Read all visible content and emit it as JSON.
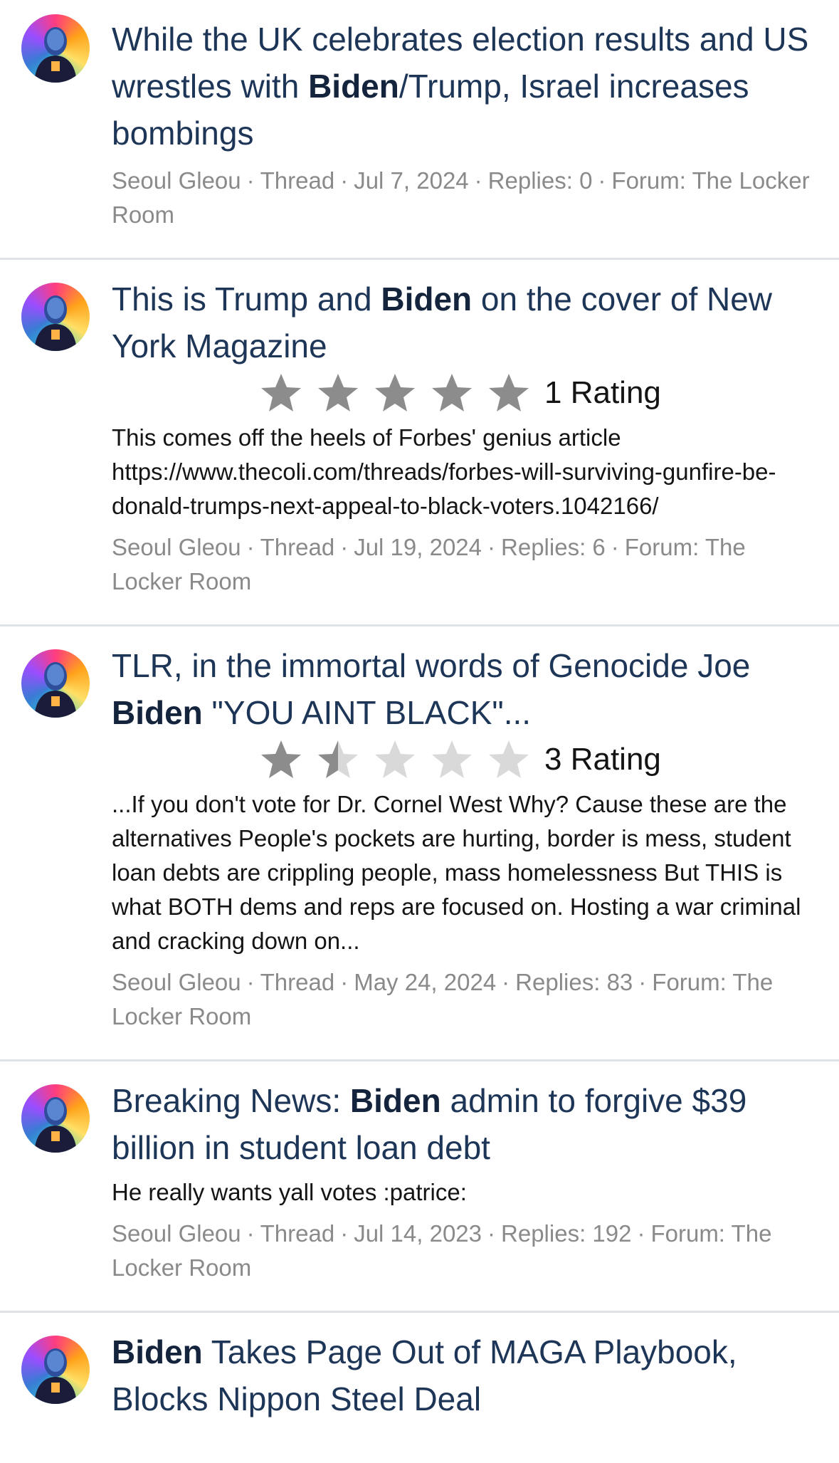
{
  "results": [
    {
      "title_parts": [
        "While the UK celebrates election results and US wrestles with ",
        "Biden",
        "/Trump, Israel increases bombings"
      ],
      "rating": null,
      "snippet": "",
      "author": "Seoul Gleou",
      "type": "Thread",
      "date": "Jul 7, 2024",
      "replies": "Replies: 0",
      "forum": "Forum: The Locker Room"
    },
    {
      "title_parts": [
        "This is Trump and ",
        "Biden",
        " on the cover of New York Magazine"
      ],
      "rating": {
        "value": 5,
        "max": 5,
        "label": "1 Rating"
      },
      "snippet": "This comes off the heels of Forbes' genius article https://www.thecoli.com/threads/forbes-will-surviving-gunfire-be-donald-trumps-next-appeal-to-black-voters.1042166/",
      "author": "Seoul Gleou",
      "type": "Thread",
      "date": "Jul 19, 2024",
      "replies": "Replies: 6",
      "forum": "Forum: The Locker Room"
    },
    {
      "title_parts": [
        "TLR, in the immortal words of Genocide Joe ",
        "Biden",
        " \"YOU AINT BLACK\"..."
      ],
      "rating": {
        "value": 1.5,
        "max": 5,
        "label": "3 Rating"
      },
      "snippet": "...If you don't vote for Dr. Cornel West Why? Cause these are the alternatives People's pockets are hurting, border is mess, student loan debts are crippling people, mass homelessness But THIS is what BOTH dems and reps are focused on. Hosting a war criminal and cracking down on...",
      "author": "Seoul Gleou",
      "type": "Thread",
      "date": "May 24, 2024",
      "replies": "Replies: 83",
      "forum": "Forum: The Locker Room"
    },
    {
      "title_parts": [
        "Breaking News: ",
        "Biden",
        " admin to forgive $39 billion in student loan debt"
      ],
      "rating": null,
      "snippet": "He really wants yall votes :patrice:",
      "author": "Seoul Gleou",
      "type": "Thread",
      "date": "Jul 14, 2023",
      "replies": "Replies: 192",
      "forum": "Forum: The Locker Room"
    },
    {
      "title_parts": [
        "",
        "Biden",
        " Takes Page Out of MAGA Playbook, Blocks Nippon Steel Deal"
      ],
      "rating": null,
      "snippet": "",
      "author": "",
      "type": "",
      "date": "",
      "replies": "",
      "forum": ""
    }
  ],
  "meta_separator": "·",
  "colors": {
    "title": "#1d3557",
    "star_filled": "#8c8c8c",
    "star_empty": "#d9d9d9",
    "meta": "#8a8a8a",
    "divider": "#dfe3e7"
  },
  "icons": {
    "avatar": "avatar-portrait-icon",
    "star": "star-icon"
  }
}
